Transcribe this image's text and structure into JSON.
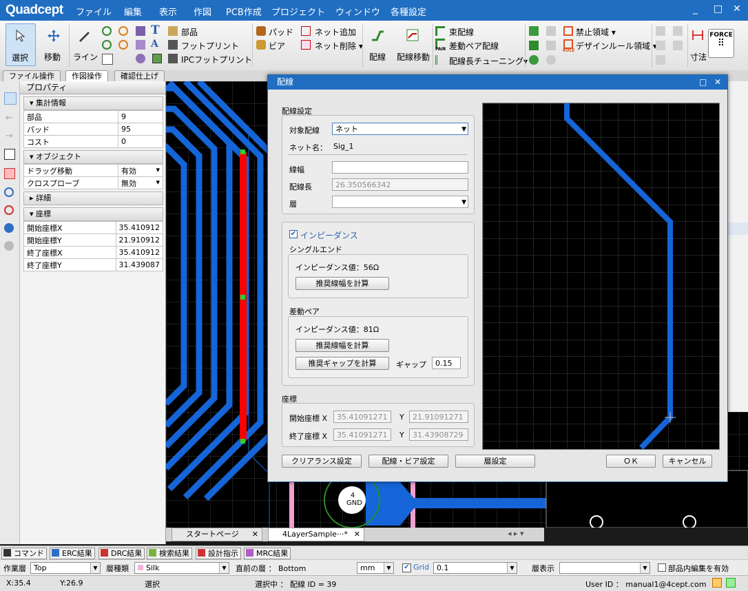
{
  "app": {
    "logo": "Quadcept"
  },
  "menu": [
    "ファイル",
    "編集",
    "表示",
    "作図",
    "PCB作成",
    "プロジェクト",
    "ウィンドウ",
    "各種設定"
  ],
  "window_controls": [
    "_",
    "□",
    "✕"
  ],
  "ribbon": {
    "select": "選択",
    "move": "移動",
    "line": "ライン",
    "part": "部品",
    "footprint": "フットプリント",
    "ipc_footprint": "IPCフットプリント",
    "pad": "パッド",
    "via": "ビア",
    "net_add": "ネット追加",
    "net_delete": "ネット削除",
    "route": "配線",
    "route_move": "配線移動",
    "bundle": "束配線",
    "diff_pair": "差動ペア配線",
    "length_tuning": "配線長チューニング",
    "keepout": "禁止領域",
    "design_rule": "デザインルール領域",
    "dimension": "寸法",
    "force": "FORCE",
    "pair_tag": "PAIR",
    "rule_tag": "RULE"
  },
  "ribbon_tabs": [
    "ファイル操作",
    "作図操作",
    "確認仕上げ"
  ],
  "properties": {
    "title": "プロパティ",
    "summary_header": "集計情報",
    "summary": [
      {
        "k": "部品",
        "v": "9"
      },
      {
        "k": "パッド",
        "v": "95"
      },
      {
        "k": "コスト",
        "v": "0"
      }
    ],
    "object_header": "オブジェクト",
    "object": [
      {
        "k": "ドラッグ移動",
        "v": "有効"
      },
      {
        "k": "クロスプローブ",
        "v": "無効"
      }
    ],
    "detail_header": "詳細",
    "coord_header": "座標",
    "coords": [
      {
        "k": "開始座標X",
        "v": "35.410912"
      },
      {
        "k": "開始座標Y",
        "v": "21.910912"
      },
      {
        "k": "終了座標X",
        "v": "35.410912"
      },
      {
        "k": "終了座標Y",
        "v": "31.439087"
      }
    ]
  },
  "dialog": {
    "title": "配線",
    "routing_settings": "配線設定",
    "target_label": "対象配線",
    "target_value": "ネット",
    "net_name_label": "ネット名：",
    "net_name_value": "Sig_1",
    "width_label": "線幅",
    "width_value": "",
    "length_label": "配線長",
    "length_value": "26.350566342",
    "layer_label": "層",
    "layer_value": "",
    "impedance_check": "インピーダンス",
    "single_end": "シングルエンド",
    "single_value": "インピーダンス値：56Ω",
    "calc_width": "推奨線幅を計算",
    "diff_pair": "差動ペア",
    "diff_value": "インピーダンス値：81Ω",
    "calc_width2": "推奨線幅を計算",
    "calc_gap": "推奨ギャップを計算",
    "gap_label": "ギャップ",
    "gap_value": "0.15",
    "coord_section": "座標",
    "start_label": "開始座標 X",
    "start_x": "35.41091271",
    "start_y": "21.91091271",
    "end_label": "終了座標 X",
    "end_x": "35.41091271",
    "end_y": "31.43908729",
    "y_label": "Y",
    "clearance_btn": "クリアランス設定",
    "route_via_btn": "配線・ビア設定",
    "layer_btn": "層設定",
    "ok_btn": "ＯＫ",
    "cancel_btn": "キャンセル"
  },
  "canvas": {
    "pad_label": "4",
    "pad_net": "GND"
  },
  "doc_tabs": [
    "スタートページ",
    "4LayerSample···*"
  ],
  "bottom_tabs": [
    "コマンド",
    "ERC結果",
    "DRC結果",
    "検索結果",
    "設計指示",
    "MRC結果"
  ],
  "layerbar": {
    "work_layer_label": "作業層",
    "work_layer": "Top",
    "layer_type_label": "層種類",
    "layer_type": "Silk",
    "prev_layer_label": "直前の層 ： Bottom",
    "unit": "mm",
    "grid_label": "Grid",
    "grid_value": "0.1",
    "layer_display_label": "層表示",
    "layer_display_value": "",
    "part_edit": "部品内編集を有効"
  },
  "status": {
    "x": "X:35.4",
    "y": "Y:26.9",
    "mode": "選択",
    "selection": "選択中 ： 配線 ID = 39",
    "user": "User ID ： manual1@4cept.com"
  },
  "colors": {
    "accent": "#1f6ec2",
    "trace": "#1565d8",
    "selected_trace": "#ff0000"
  }
}
